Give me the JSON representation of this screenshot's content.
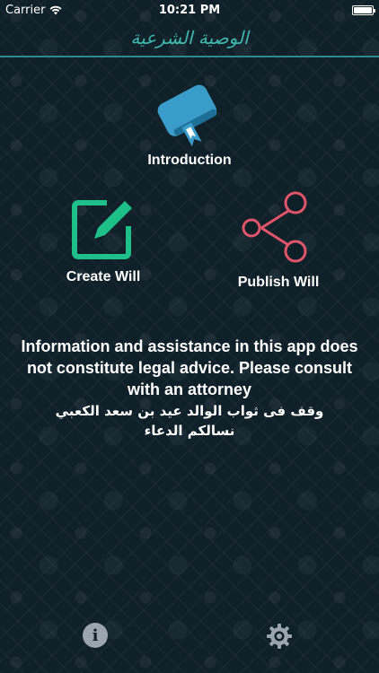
{
  "status_bar": {
    "carrier": "Carrier",
    "time": "10:21 PM"
  },
  "nav": {
    "title": "الوصية الشرعية"
  },
  "menu": {
    "introduction": "Introduction",
    "create_will": "Create Will",
    "publish_will": "Publish Will"
  },
  "notice": {
    "disclaimer": "Information and assistance in this app does not constitute legal advice. Please consult with an attorney",
    "dedication_line1": "وقف فى ثواب الوالد عيد بن سعد الكعبي",
    "dedication_line2": "نسالكم الدعاء"
  },
  "tab_bar": {
    "info_glyph": "i"
  },
  "colors": {
    "accent_teal": "#3fb8ad",
    "book_blue": "#3a9cc8",
    "create_green": "#1fbf8a",
    "publish_red": "#e0556a"
  },
  "icons": [
    "wifi-icon",
    "battery-icon",
    "book-icon",
    "edit-icon",
    "share-icon",
    "info-icon",
    "gear-icon"
  ]
}
